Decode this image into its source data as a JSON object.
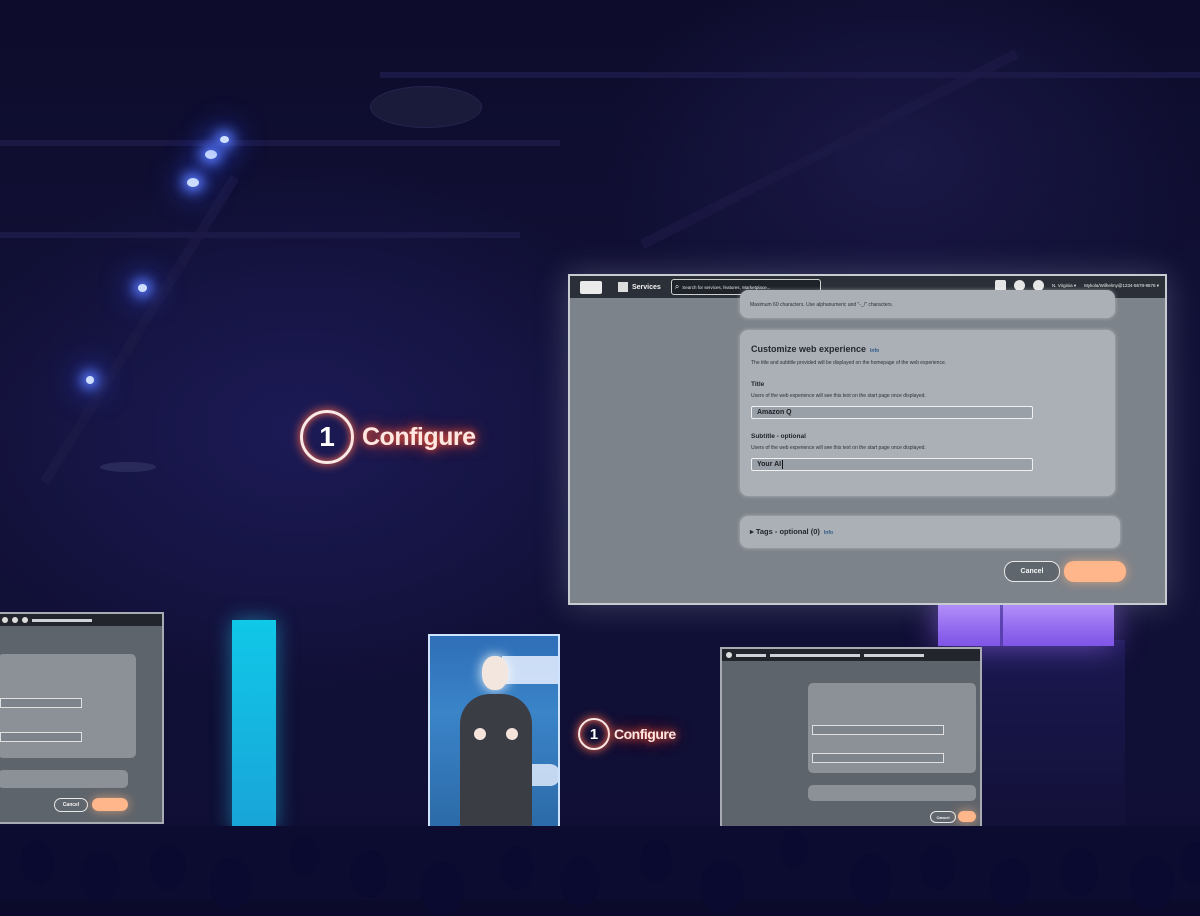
{
  "stage": {
    "label_number": "1",
    "label_text": "Configure"
  },
  "main_screen": {
    "topbar": {
      "services_label": "Services",
      "search_placeholder": "Search for services, features, Marketplace...",
      "region_label": "N. Virginia ▾",
      "account_label": "Mykola/Wilhelmy@1234-5678-9876 ▾"
    },
    "top_card_text": "Maximum 60 characters. Use alphanumeric and \"-_/\" characters.",
    "customize_card": {
      "title": "Customize web experience",
      "info": "Info",
      "description": "The title and subtitle provided will be displayed on the homepage of the web experience.",
      "title_field": {
        "label": "Title",
        "description": "Users of the web experience will see this text on the start page once displayed.",
        "value": "Amazon Q"
      },
      "subtitle_field": {
        "label": "Subtitle - optional",
        "description": "Users of the web experience will see this text on the start page once displayed.",
        "value": "Your AI"
      }
    },
    "tags_card": {
      "label": "▸ Tags - optional (0)",
      "info": "Info"
    },
    "cancel_label": "Cancel",
    "primary_label": ""
  },
  "left_screen": {
    "cancel_label": "Cancel"
  },
  "right_screen": {
    "cancel_label": "Cancel"
  },
  "colors": {
    "venue_background": "#0b0a2a",
    "label_glow": "#ff5a3a",
    "console_screen": "#7d838a",
    "primary_button": "#ffb68a",
    "purple_light": "#9a6cf0",
    "cyan_panel": "#19b4e0"
  }
}
